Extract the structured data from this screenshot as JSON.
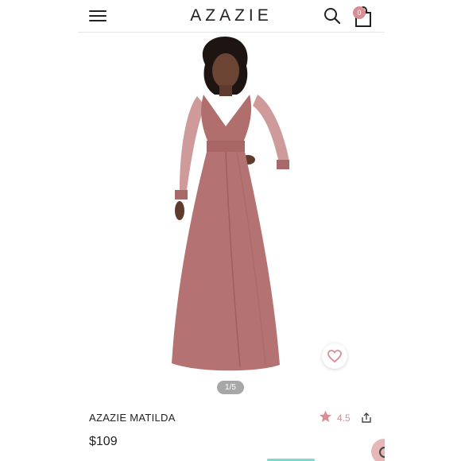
{
  "header": {
    "logo": "AZAZIE",
    "cart_count": "0",
    "icons": [
      "menu-icon",
      "search-icon",
      "shopping-bag-icon"
    ]
  },
  "gallery": {
    "pager": "1/5"
  },
  "product": {
    "title": "AZAZIE MATILDA",
    "rating": "4.5",
    "price": "$109"
  },
  "colors": {
    "accent": "#d98e94",
    "dress": "#b57272"
  }
}
